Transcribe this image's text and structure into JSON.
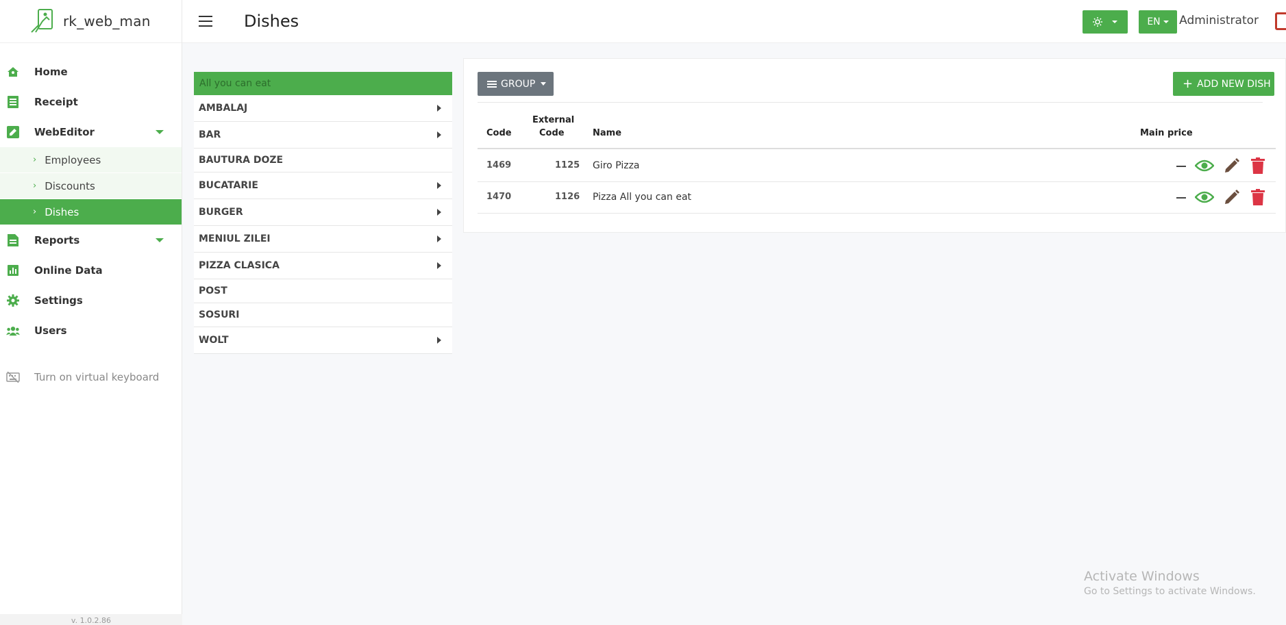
{
  "app": {
    "name": "rk_web_man",
    "version": "v. 1.0.2.86"
  },
  "header": {
    "title": "Dishes",
    "lang": "EN",
    "user": "Administrator"
  },
  "sidebar": {
    "items": [
      {
        "label": "Home",
        "icon": "home-icon"
      },
      {
        "label": "Receipt",
        "icon": "receipt-icon"
      },
      {
        "label": "WebEditor",
        "icon": "edit-icon"
      },
      {
        "label": "Reports",
        "icon": "report-icon"
      },
      {
        "label": "Online Data",
        "icon": "chart-icon"
      },
      {
        "label": "Settings",
        "icon": "gear-icon"
      },
      {
        "label": "Users",
        "icon": "users-icon"
      }
    ],
    "subitems": [
      {
        "label": "Employees"
      },
      {
        "label": "Discounts"
      },
      {
        "label": "Dishes"
      }
    ],
    "keyboard": "Turn on virtual keyboard"
  },
  "groups": {
    "selected": "All you can eat",
    "items": [
      {
        "label": "AMBALAJ",
        "has_children": true
      },
      {
        "label": "BAR",
        "has_children": true
      },
      {
        "label": "BAUTURA DOZE",
        "has_children": false
      },
      {
        "label": "BUCATARIE",
        "has_children": true
      },
      {
        "label": "BURGER",
        "has_children": true
      },
      {
        "label": "MENIUL ZILEI",
        "has_children": true
      },
      {
        "label": "PIZZA CLASICA",
        "has_children": true
      },
      {
        "label": "POST",
        "has_children": false
      },
      {
        "label": "SOSURI",
        "has_children": false
      },
      {
        "label": "WOLT",
        "has_children": true
      }
    ]
  },
  "dishes": {
    "group_button": "GROUP",
    "add_button": "ADD NEW DISH",
    "columns": {
      "code": "Code",
      "external_1": "External",
      "external_2": "Code",
      "name": "Name",
      "price": "Main price"
    },
    "rows": [
      {
        "code": "1469",
        "external": "1125",
        "name": "Giro Pizza"
      },
      {
        "code": "1470",
        "external": "1126",
        "name": "Pizza All you can eat"
      }
    ]
  },
  "watermark": {
    "line1": "Activate Windows",
    "line2": "Go to Settings to activate Windows."
  },
  "colors": {
    "accent": "#4cad4c",
    "danger": "#dc3545",
    "edit": "#6b4f3f",
    "secondary": "#6c757d"
  }
}
